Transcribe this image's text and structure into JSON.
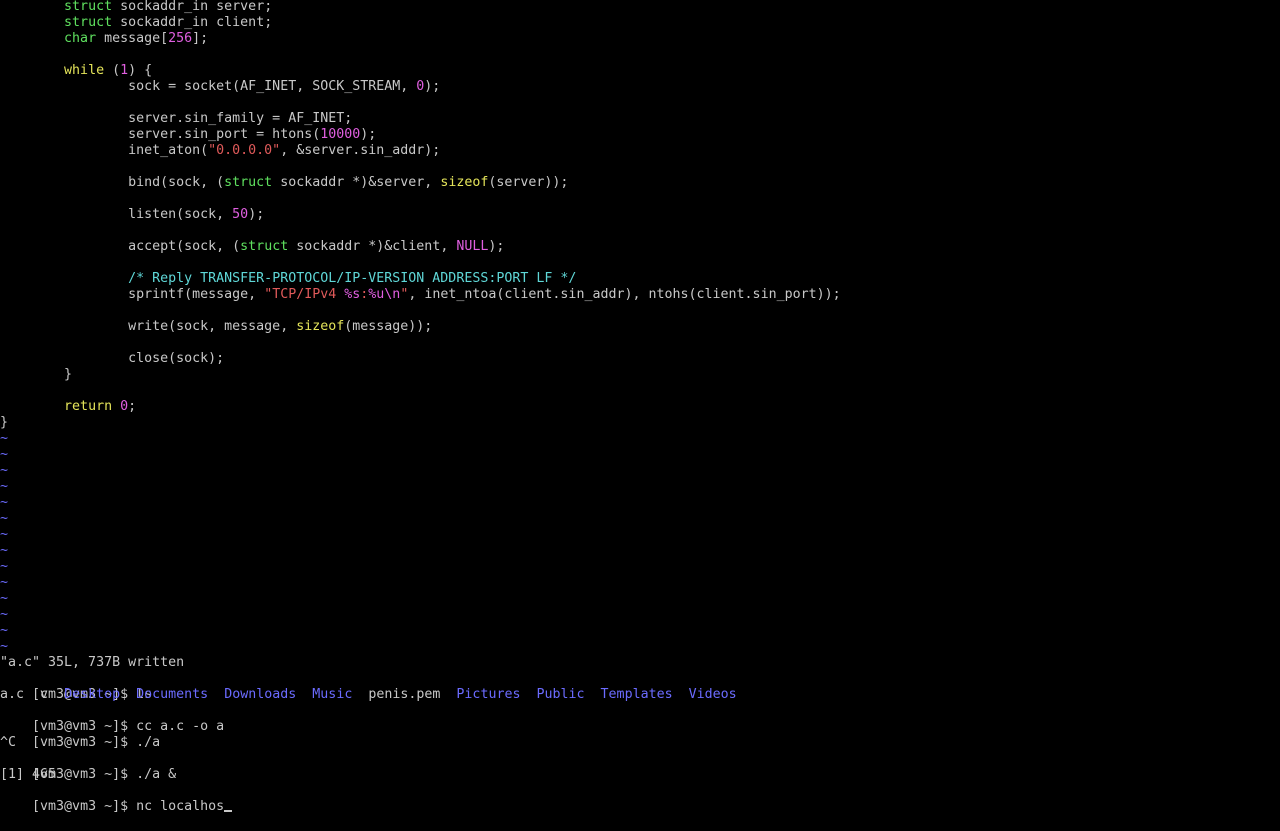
{
  "editor": {
    "code": [
      [
        {
          "t": "        "
        },
        {
          "t": "struct",
          "c": "type"
        },
        {
          "t": " sockaddr_in server;"
        }
      ],
      [
        {
          "t": "        "
        },
        {
          "t": "struct",
          "c": "type"
        },
        {
          "t": " sockaddr_in client;"
        }
      ],
      [
        {
          "t": "        "
        },
        {
          "t": "char",
          "c": "type"
        },
        {
          "t": " message["
        },
        {
          "t": "256",
          "c": "num"
        },
        {
          "t": "];"
        }
      ],
      [
        {
          "t": ""
        }
      ],
      [
        {
          "t": "        "
        },
        {
          "t": "while",
          "c": "kw"
        },
        {
          "t": " ("
        },
        {
          "t": "1",
          "c": "num"
        },
        {
          "t": ") {"
        }
      ],
      [
        {
          "t": "                sock = socket(AF_INET, SOCK_STREAM, "
        },
        {
          "t": "0",
          "c": "num"
        },
        {
          "t": ");"
        }
      ],
      [
        {
          "t": ""
        }
      ],
      [
        {
          "t": "                server.sin_family = AF_INET;"
        }
      ],
      [
        {
          "t": "                server.sin_port = htons("
        },
        {
          "t": "10000",
          "c": "num"
        },
        {
          "t": ");"
        }
      ],
      [
        {
          "t": "                inet_aton("
        },
        {
          "t": "\"0.0.0.0\"",
          "c": "str"
        },
        {
          "t": ", &server.sin_addr);"
        }
      ],
      [
        {
          "t": ""
        }
      ],
      [
        {
          "t": "                bind(sock, ("
        },
        {
          "t": "struct",
          "c": "type"
        },
        {
          "t": " sockaddr *)&server, "
        },
        {
          "t": "sizeof",
          "c": "kw"
        },
        {
          "t": "(server));"
        }
      ],
      [
        {
          "t": ""
        }
      ],
      [
        {
          "t": "                listen(sock, "
        },
        {
          "t": "50",
          "c": "num"
        },
        {
          "t": ");"
        }
      ],
      [
        {
          "t": ""
        }
      ],
      [
        {
          "t": "                accept(sock, ("
        },
        {
          "t": "struct",
          "c": "type"
        },
        {
          "t": " sockaddr *)&client, "
        },
        {
          "t": "NULL",
          "c": "num"
        },
        {
          "t": ");"
        }
      ],
      [
        {
          "t": ""
        }
      ],
      [
        {
          "t": "                "
        },
        {
          "t": "/* Reply TRANSFER-PROTOCOL/IP-VERSION ADDRESS:PORT LF */",
          "c": "cmt"
        }
      ],
      [
        {
          "t": "                sprintf(message, "
        },
        {
          "t": "\"TCP/IPv4 ",
          "c": "str"
        },
        {
          "t": "%s",
          "c": "num"
        },
        {
          "t": ":",
          "c": "str"
        },
        {
          "t": "%u\\n",
          "c": "num"
        },
        {
          "t": "\"",
          "c": "str"
        },
        {
          "t": ", inet_ntoa(client.sin_addr), ntohs(client.sin_port));"
        }
      ],
      [
        {
          "t": ""
        }
      ],
      [
        {
          "t": "                write(sock, message, "
        },
        {
          "t": "sizeof",
          "c": "kw"
        },
        {
          "t": "(message));"
        }
      ],
      [
        {
          "t": ""
        }
      ],
      [
        {
          "t": "                close(sock);"
        }
      ],
      [
        {
          "t": "        }"
        }
      ],
      [
        {
          "t": ""
        }
      ],
      [
        {
          "t": "        "
        },
        {
          "t": "return",
          "c": "kw"
        },
        {
          "t": " "
        },
        {
          "t": "0",
          "c": "num"
        },
        {
          "t": ";"
        }
      ],
      [
        {
          "t": "}"
        }
      ]
    ],
    "tilde_char": "~",
    "tilde_count": 14,
    "status": "\"a.c\" 35L, 737B written"
  },
  "shell": {
    "prompt": "[vm3@vm3 ~]$ ",
    "cmd_ls": "ls",
    "ls_entries": [
      {
        "name": "a.c",
        "kind": "file"
      },
      {
        "name": "c",
        "kind": "file"
      },
      {
        "name": "Desktop",
        "kind": "dir"
      },
      {
        "name": "Documents",
        "kind": "dir"
      },
      {
        "name": "Downloads",
        "kind": "dir"
      },
      {
        "name": "Music",
        "kind": "dir"
      },
      {
        "name": "penis.pem",
        "kind": "file"
      },
      {
        "name": "Pictures",
        "kind": "dir"
      },
      {
        "name": "Public",
        "kind": "dir"
      },
      {
        "name": "Templates",
        "kind": "dir"
      },
      {
        "name": "Videos",
        "kind": "dir"
      }
    ],
    "cmd_cc": "cc a.c -o a",
    "cmd_run": "./a",
    "interrupt": "^C",
    "cmd_bg": "./a &",
    "job": "[1] 465",
    "current_input": "nc localhos"
  },
  "colors": {
    "background": "#000000",
    "foreground": "#c8c8c8",
    "keyword": "#e5e55a",
    "type": "#5fe05f",
    "number": "#e05fe0",
    "string": "#e05a5a",
    "comment": "#5fd7d7",
    "directory": "#6b6bff",
    "tilde": "#6b6bff"
  }
}
